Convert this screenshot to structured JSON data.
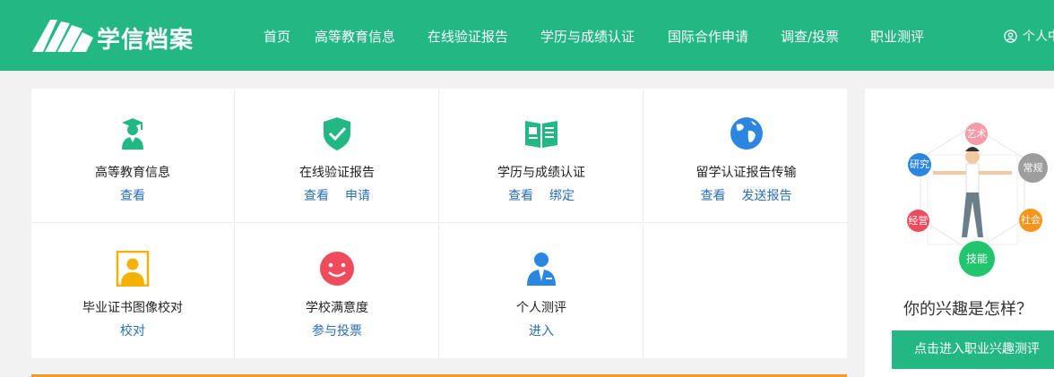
{
  "header": {
    "logo_text": "学信档案",
    "nav": [
      "首页",
      "高等教育信息",
      "在线验证报告",
      "学历与成绩认证",
      "国际合作申请",
      "调查/投票",
      "职业测评"
    ],
    "user_label": "个人中心"
  },
  "services": [
    {
      "title": "高等教育信息",
      "links": [
        "查看"
      ],
      "icon": "graduate-icon"
    },
    {
      "title": "在线验证报告",
      "links": [
        "查看",
        "申请"
      ],
      "icon": "shield-check-icon"
    },
    {
      "title": "学历与成绩认证",
      "links": [
        "查看",
        "绑定"
      ],
      "icon": "book-icon"
    },
    {
      "title": "留学认证报告传输",
      "links": [
        "查看",
        "发送报告"
      ],
      "icon": "globe-icon"
    },
    {
      "title": "毕业证书图像校对",
      "links": [
        "校对"
      ],
      "icon": "portrait-icon"
    },
    {
      "title": "学校满意度",
      "links": [
        "参与投票"
      ],
      "icon": "smiley-icon"
    },
    {
      "title": "个人测评",
      "links": [
        "进入"
      ],
      "icon": "businessman-icon"
    }
  ],
  "side": {
    "bubbles": [
      "艺术",
      "研究",
      "常规",
      "经营",
      "社会",
      "技能"
    ],
    "title": "你的兴趣是怎样？",
    "button": "点击进入职业兴趣测评"
  },
  "colors": {
    "brand": "#22b783",
    "link": "#2a6fb4",
    "orange": "#f39a2f"
  }
}
